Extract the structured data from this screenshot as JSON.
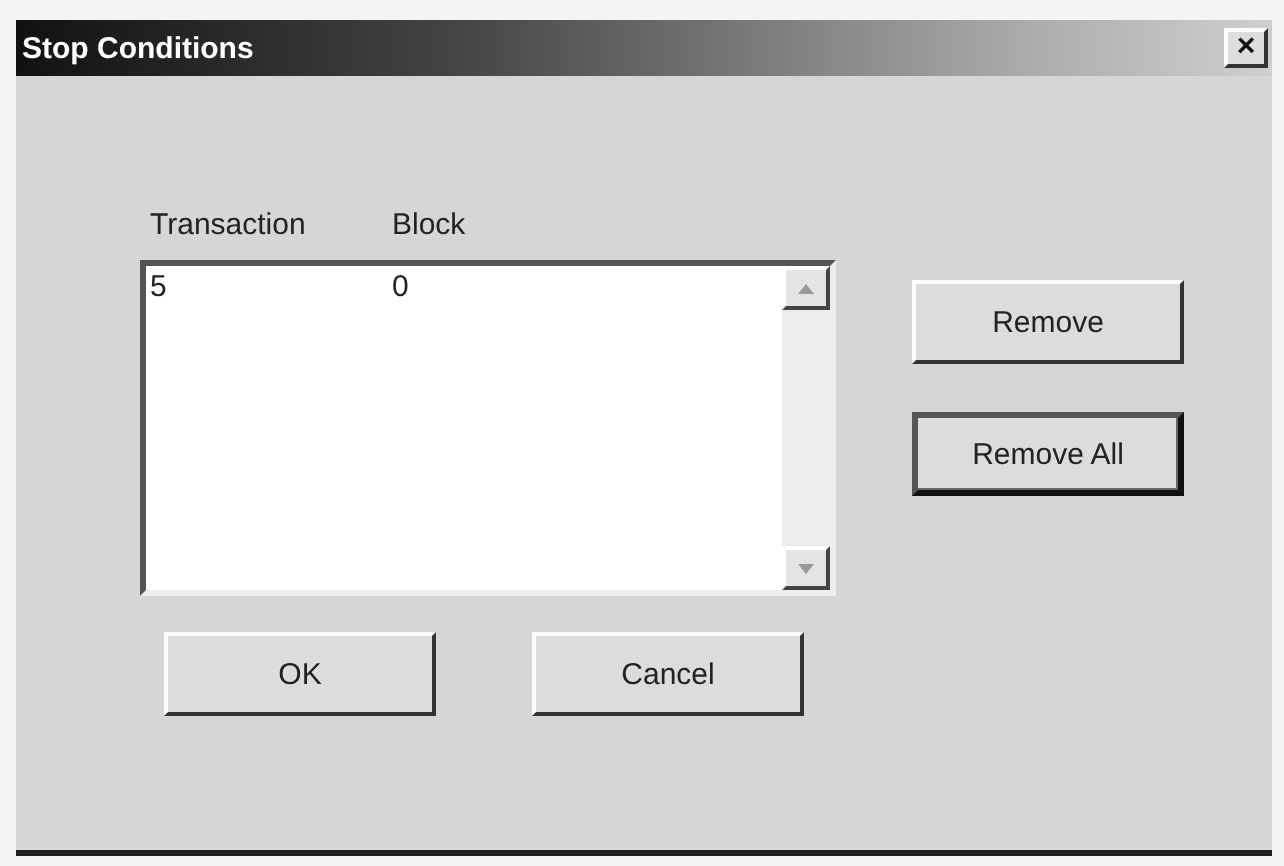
{
  "window": {
    "title": "Stop Conditions",
    "close": "×"
  },
  "list": {
    "columns": [
      "Transaction",
      "Block"
    ],
    "rows": [
      {
        "cells": [
          "5",
          "0"
        ]
      }
    ]
  },
  "side_buttons": [
    {
      "label": "Remove",
      "default": false
    },
    {
      "label": "Remove All",
      "default": true
    }
  ],
  "bottom_buttons": [
    {
      "label": "OK",
      "default": false
    },
    {
      "label": "Cancel",
      "default": false
    }
  ]
}
